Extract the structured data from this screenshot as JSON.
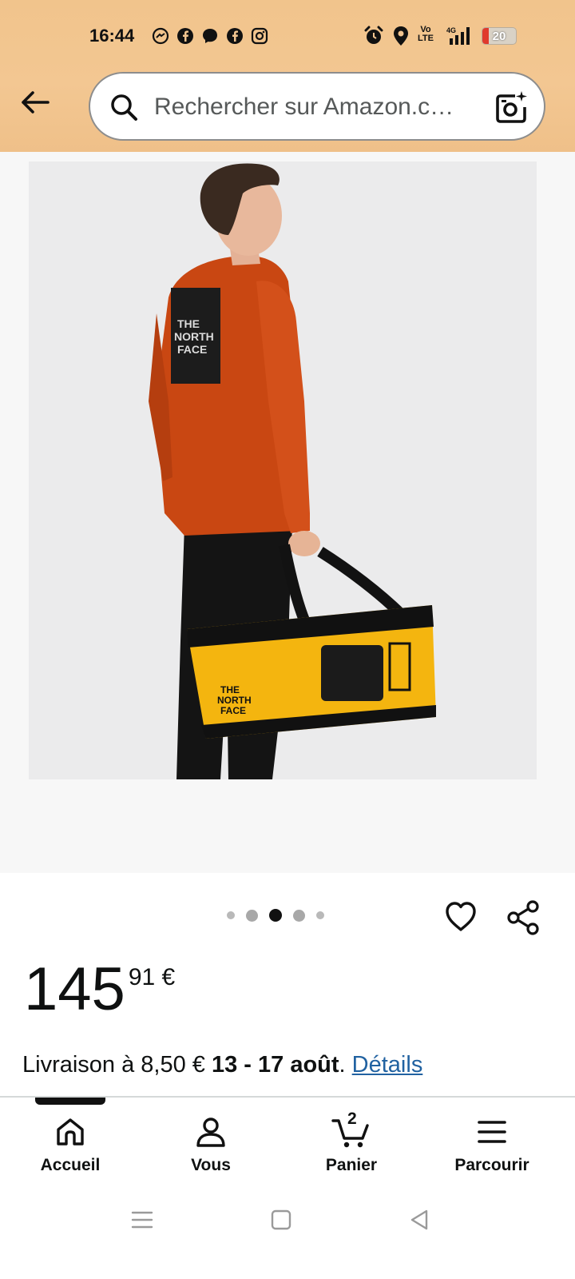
{
  "status_bar": {
    "time": "16:44",
    "notification_icons": [
      "messenger-icon",
      "facebook-icon",
      "messenger-chat-icon",
      "facebook-icon",
      "instagram-icon"
    ],
    "right_icons": [
      "alarm-icon",
      "location-icon",
      "volte-icon",
      "signal-4g-icon"
    ],
    "volte_label": "Vo\nLTE",
    "network_label": "4G",
    "battery_level": "20"
  },
  "header": {
    "search_placeholder": "Rechercher sur Amazon.c…",
    "accent_bg": "#f3c792"
  },
  "product": {
    "image_alt": "Sac The North Face jaune porté par un homme",
    "carousel_total": 5,
    "carousel_active": 3,
    "price_whole": "145",
    "price_fraction": "91 €"
  },
  "delivery": {
    "prefix": "Livraison à 8,50 € ",
    "dates": "13 - 17 août",
    "separator": ". ",
    "link": "Détails"
  },
  "bottom_nav": {
    "items": [
      {
        "label": "Accueil",
        "icon": "home-icon"
      },
      {
        "label": "Vous",
        "icon": "user-icon"
      },
      {
        "label": "Panier",
        "icon": "cart-icon"
      },
      {
        "label": "Parcourir",
        "icon": "menu-icon"
      }
    ],
    "cart_count": "2"
  }
}
